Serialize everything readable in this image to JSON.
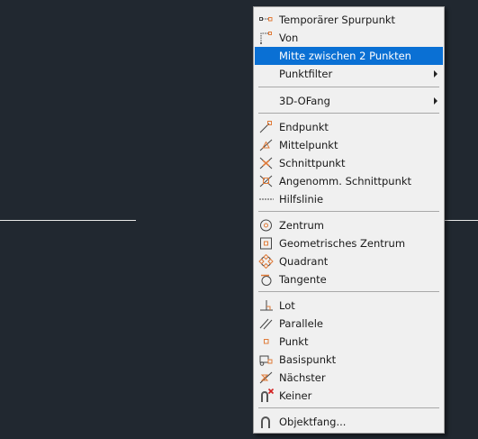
{
  "colors": {
    "canvas_background": "#212830",
    "menu_background": "#f0f0f0",
    "selected_background": "#0a70d4",
    "icon_accent": "#e07b39"
  },
  "menu": {
    "items": [
      {
        "label": "Temporärer Spurpunkt",
        "icon": "temporary-track-point-icon"
      },
      {
        "label": "Von",
        "icon": "from-icon"
      },
      {
        "label": "Mitte zwischen 2 Punkten",
        "icon": "",
        "selected": true
      },
      {
        "label": "Punktfilter",
        "icon": "",
        "submenu": true
      },
      {
        "label": "3D-OFang",
        "icon": "",
        "submenu": true
      },
      {
        "label": "Endpunkt",
        "icon": "endpoint-snap-icon"
      },
      {
        "label": "Mittelpunkt",
        "icon": "midpoint-snap-icon"
      },
      {
        "label": "Schnittpunkt",
        "icon": "intersection-snap-icon"
      },
      {
        "label": "Angenomm. Schnittpunkt",
        "icon": "apparent-intersection-snap-icon"
      },
      {
        "label": "Hilfslinie",
        "icon": "extension-snap-icon"
      },
      {
        "label": "Zentrum",
        "icon": "center-snap-icon"
      },
      {
        "label": "Geometrisches Zentrum",
        "icon": "geometric-center-snap-icon"
      },
      {
        "label": "Quadrant",
        "icon": "quadrant-snap-icon"
      },
      {
        "label": "Tangente",
        "icon": "tangent-snap-icon"
      },
      {
        "label": "Lot",
        "icon": "perpendicular-snap-icon"
      },
      {
        "label": "Parallele",
        "icon": "parallel-snap-icon"
      },
      {
        "label": "Punkt",
        "icon": "node-snap-icon"
      },
      {
        "label": "Basispunkt",
        "icon": "insertion-snap-icon"
      },
      {
        "label": "Nächster",
        "icon": "nearest-snap-icon"
      },
      {
        "label": "Keiner",
        "icon": "none-snap-icon"
      },
      {
        "label": "Objektfang...",
        "icon": "object-snap-settings-icon"
      }
    ]
  }
}
